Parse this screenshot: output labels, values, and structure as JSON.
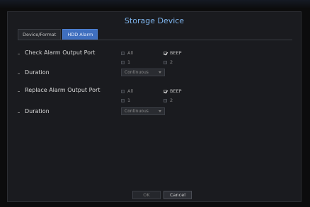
{
  "dialog": {
    "title": "Storage Device",
    "tabs": [
      {
        "label": "Device/Format",
        "active": false
      },
      {
        "label": "HDD Alarm",
        "active": true
      }
    ]
  },
  "sections": [
    {
      "port_label": "Check Alarm Output Port",
      "options": [
        {
          "label": "All",
          "checked": false
        },
        {
          "label": "BEEP",
          "checked": true
        },
        {
          "label": "1",
          "checked": false
        },
        {
          "label": "2",
          "checked": false
        }
      ],
      "duration_label": "Duration",
      "duration_value": "Continuous"
    },
    {
      "port_label": "Replace Alarm Output Port",
      "options": [
        {
          "label": "All",
          "checked": false
        },
        {
          "label": "BEEP",
          "checked": true
        },
        {
          "label": "1",
          "checked": false
        },
        {
          "label": "2",
          "checked": false
        }
      ],
      "duration_label": "Duration",
      "duration_value": "Continuous"
    }
  ],
  "footer": {
    "ok_label": "OK",
    "cancel_label": "Cancel"
  },
  "colors": {
    "accent": "#3f6fbf",
    "title": "#7eb4ec",
    "background": "#1a1b1f"
  }
}
